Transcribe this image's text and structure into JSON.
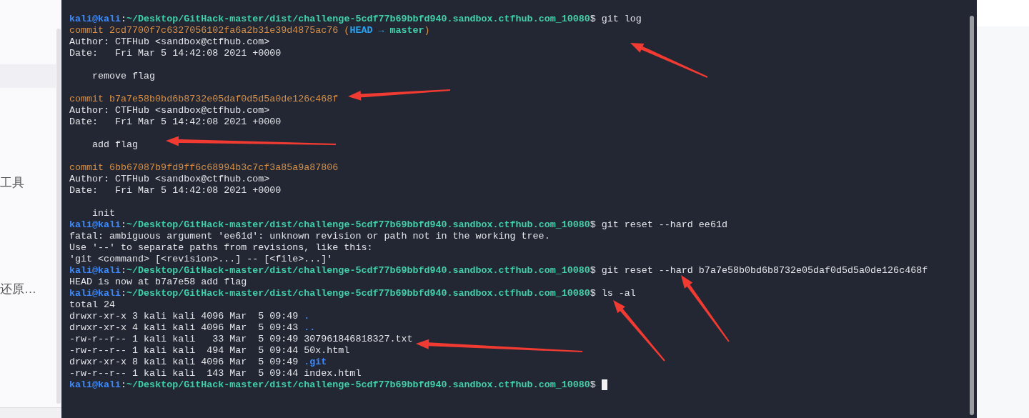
{
  "left_panel": {
    "items": [
      {
        "label": "工具"
      },
      {
        "label": "还原…"
      }
    ]
  },
  "terminal": {
    "lines": [
      {
        "kind": "text",
        "segments": [
          {
            "text": "kali@kali",
            "kind": "user"
          },
          {
            "text": ":",
            "kind": "plain"
          },
          {
            "text": "~/Desktop/GitHack-master/dist/challenge-5cdf77b69bbfd940.sandbox.ctfhub.com_10080",
            "kind": "path"
          },
          {
            "text": "$ git log",
            "kind": "plain"
          }
        ]
      },
      {
        "kind": "text",
        "segments": [
          {
            "text": "commit 2cd7700f7c6327056102fa6a2b31e39d4875ac76 (",
            "kind": "commit"
          },
          {
            "text": "HEAD → ",
            "kind": "head"
          },
          {
            "text": "master",
            "kind": "branch"
          },
          {
            "text": ")",
            "kind": "commit"
          }
        ]
      },
      {
        "kind": "text",
        "segments": [
          {
            "text": "Author: CTFHub <sandbox@ctfhub.com>",
            "kind": "plain"
          }
        ]
      },
      {
        "kind": "text",
        "segments": [
          {
            "text": "Date:   Fri Mar 5 14:42:08 2021 +0000",
            "kind": "plain"
          }
        ]
      },
      {
        "kind": "blank"
      },
      {
        "kind": "text",
        "segments": [
          {
            "text": "    remove flag",
            "kind": "plain"
          }
        ]
      },
      {
        "kind": "blank"
      },
      {
        "kind": "text",
        "segments": [
          {
            "text": "commit b7a7e58b0bd6b8732e05daf0d5d5a0de126c468f",
            "kind": "commit"
          }
        ]
      },
      {
        "kind": "text",
        "segments": [
          {
            "text": "Author: CTFHub <sandbox@ctfhub.com>",
            "kind": "plain"
          }
        ]
      },
      {
        "kind": "text",
        "segments": [
          {
            "text": "Date:   Fri Mar 5 14:42:08 2021 +0000",
            "kind": "plain"
          }
        ]
      },
      {
        "kind": "blank"
      },
      {
        "kind": "text",
        "segments": [
          {
            "text": "    add flag",
            "kind": "plain"
          }
        ]
      },
      {
        "kind": "blank"
      },
      {
        "kind": "text",
        "segments": [
          {
            "text": "commit 6bb67087b9fd9ff6c68994b3c7cf3a85a9a87806",
            "kind": "commit"
          }
        ]
      },
      {
        "kind": "text",
        "segments": [
          {
            "text": "Author: CTFHub <sandbox@ctfhub.com>",
            "kind": "plain"
          }
        ]
      },
      {
        "kind": "text",
        "segments": [
          {
            "text": "Date:   Fri Mar 5 14:42:08 2021 +0000",
            "kind": "plain"
          }
        ]
      },
      {
        "kind": "blank"
      },
      {
        "kind": "text",
        "segments": [
          {
            "text": "    init",
            "kind": "plain"
          }
        ]
      },
      {
        "kind": "text",
        "segments": [
          {
            "text": "kali@kali",
            "kind": "user"
          },
          {
            "text": ":",
            "kind": "plain"
          },
          {
            "text": "~/Desktop/GitHack-master/dist/challenge-5cdf77b69bbfd940.sandbox.ctfhub.com_10080",
            "kind": "path"
          },
          {
            "text": "$ git reset --hard ee61d",
            "kind": "plain"
          }
        ]
      },
      {
        "kind": "text",
        "segments": [
          {
            "text": "fatal: ambiguous argument 'ee61d': unknown revision or path not in the working tree.",
            "kind": "plain"
          }
        ]
      },
      {
        "kind": "text",
        "segments": [
          {
            "text": "Use '--' to separate paths from revisions, like this:",
            "kind": "plain"
          }
        ]
      },
      {
        "kind": "text",
        "segments": [
          {
            "text": "'git <command> [<revision>...] -- [<file>...]'",
            "kind": "plain"
          }
        ]
      },
      {
        "kind": "text",
        "segments": [
          {
            "text": "kali@kali",
            "kind": "user"
          },
          {
            "text": ":",
            "kind": "plain"
          },
          {
            "text": "~/Desktop/GitHack-master/dist/challenge-5cdf77b69bbfd940.sandbox.ctfhub.com_10080",
            "kind": "path"
          },
          {
            "text": "$ git reset --hard b7a7e58b0bd6b8732e05daf0d5d5a0de126c468f",
            "kind": "plain"
          }
        ]
      },
      {
        "kind": "text",
        "segments": [
          {
            "text": "HEAD is now at b7a7e58 add flag",
            "kind": "plain"
          }
        ]
      },
      {
        "kind": "text",
        "segments": [
          {
            "text": "kali@kali",
            "kind": "user"
          },
          {
            "text": ":",
            "kind": "plain"
          },
          {
            "text": "~/Desktop/GitHack-master/dist/challenge-5cdf77b69bbfd940.sandbox.ctfhub.com_10080",
            "kind": "path"
          },
          {
            "text": "$ ls -al",
            "kind": "plain"
          }
        ]
      },
      {
        "kind": "text",
        "segments": [
          {
            "text": "total 24",
            "kind": "plain"
          }
        ]
      },
      {
        "kind": "text",
        "segments": [
          {
            "text": "drwxr-xr-x 3 kali kali 4096 Mar  5 09:49 ",
            "kind": "plain"
          },
          {
            "text": ".",
            "kind": "dir"
          }
        ]
      },
      {
        "kind": "text",
        "segments": [
          {
            "text": "drwxr-xr-x 4 kali kali 4096 Mar  5 09:43 ",
            "kind": "plain"
          },
          {
            "text": "..",
            "kind": "dir"
          }
        ]
      },
      {
        "kind": "text",
        "segments": [
          {
            "text": "-rw-r--r-- 1 kali kali   33 Mar  5 09:49 307961846818327.txt",
            "kind": "plain"
          }
        ]
      },
      {
        "kind": "text",
        "segments": [
          {
            "text": "-rw-r--r-- 1 kali kali  494 Mar  5 09:44 50x.html",
            "kind": "plain"
          }
        ]
      },
      {
        "kind": "text",
        "segments": [
          {
            "text": "drwxr-xr-x 8 kali kali 4096 Mar  5 09:49 ",
            "kind": "plain"
          },
          {
            "text": ".git",
            "kind": "dir"
          }
        ]
      },
      {
        "kind": "text",
        "segments": [
          {
            "text": "-rw-r--r-- 1 kali kali  143 Mar  5 09:44 index.html",
            "kind": "plain"
          }
        ]
      },
      {
        "kind": "text",
        "cursor": true,
        "segments": [
          {
            "text": "kali@kali",
            "kind": "user"
          },
          {
            "text": ":",
            "kind": "plain"
          },
          {
            "text": "~/Desktop/GitHack-master/dist/challenge-5cdf77b69bbfd940.sandbox.ctfhub.com_10080",
            "kind": "path"
          },
          {
            "text": "$ ",
            "kind": "plain"
          }
        ]
      }
    ]
  }
}
